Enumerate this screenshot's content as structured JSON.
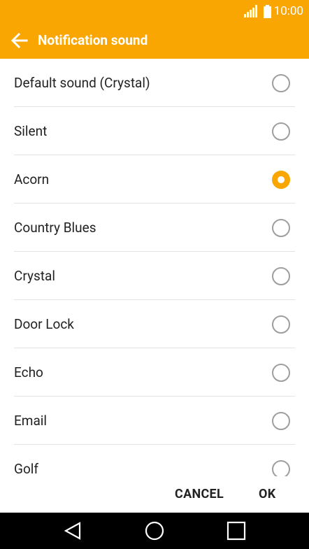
{
  "status_bar": {
    "time": "10:00",
    "icons": [
      "signal-icon",
      "battery-icon"
    ]
  },
  "header": {
    "title": "Notification sound",
    "back_icon": "arrow-left-icon"
  },
  "sound_list": {
    "selected": "Acorn",
    "items": [
      {
        "label": "Default sound (Crystal)",
        "selected": false
      },
      {
        "label": "Silent",
        "selected": false
      },
      {
        "label": "Acorn",
        "selected": true
      },
      {
        "label": "Country Blues",
        "selected": false
      },
      {
        "label": "Crystal",
        "selected": false
      },
      {
        "label": "Door Lock",
        "selected": false
      },
      {
        "label": "Echo",
        "selected": false
      },
      {
        "label": "Email",
        "selected": false
      },
      {
        "label": "Golf",
        "selected": false
      }
    ]
  },
  "dialog_buttons": {
    "cancel_label": "CANCEL",
    "ok_label": "OK"
  },
  "nav_bar": {
    "icons": [
      "back-triangle-icon",
      "home-circle-icon",
      "recents-square-icon"
    ]
  },
  "colors": {
    "accent": "#f9a502",
    "radio_off": "#9e9e9e",
    "divider": "#e2e2e2",
    "nav_bg": "#000000"
  }
}
